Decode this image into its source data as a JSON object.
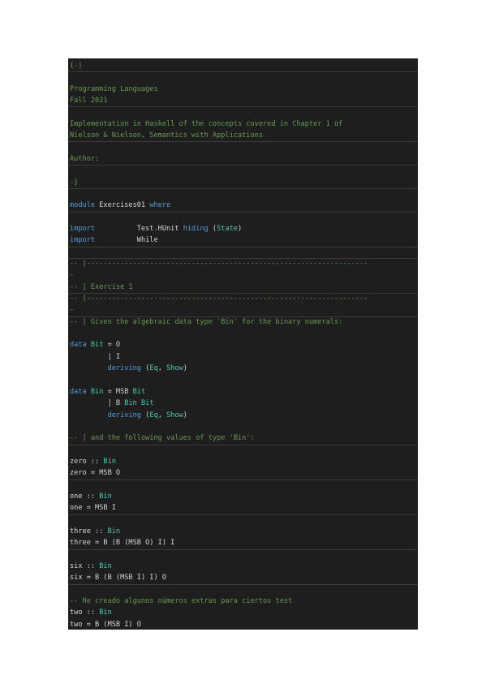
{
  "colors": {
    "background": "#1e1e1e",
    "page": "#ffffff",
    "comment": "#6a9955",
    "keyword": "#569cd6",
    "type": "#4ec9b0",
    "constructor": "#9cdcfe",
    "text": "#d4d4d4"
  },
  "code": {
    "lines": [
      [
        {
          "t": "{-|",
          "k": "comment"
        }
      ],
      [],
      [
        {
          "t": "Programming Languages",
          "k": "comment"
        }
      ],
      [
        {
          "t": "Fall 2021",
          "k": "comment"
        }
      ],
      [],
      [
        {
          "t": "Implementation in Haskell of the concepts covered in Chapter 1 of",
          "k": "comment"
        }
      ],
      [
        {
          "t": "Nielson & Nielson, Semantics with Applications",
          "k": "comment"
        }
      ],
      [],
      [
        {
          "t": "Author:",
          "k": "comment"
        }
      ],
      [],
      [
        {
          "t": "-}",
          "k": "comment"
        }
      ],
      [],
      [
        {
          "t": "module ",
          "k": "kw"
        },
        {
          "t": "Exercises01",
          "k": "plain"
        },
        {
          "t": " where",
          "k": "kw"
        }
      ],
      [],
      [
        {
          "t": "import",
          "k": "kw"
        },
        {
          "t": "          Test.HUnit ",
          "k": "plain"
        },
        {
          "t": "hiding",
          "k": "kw"
        },
        {
          "t": " (",
          "k": "plain"
        },
        {
          "t": "State",
          "k": "type"
        },
        {
          "t": ")",
          "k": "plain"
        }
      ],
      [
        {
          "t": "import",
          "k": "kw"
        },
        {
          "t": "          While",
          "k": "plain"
        }
      ],
      [],
      [
        {
          "t": "-- |-------------------------------------------------------------------",
          "k": "comment"
        }
      ],
      [
        {
          "t": "-",
          "k": "comment"
        }
      ],
      [
        {
          "t": "-- | Exercise 1",
          "k": "comment"
        }
      ],
      [
        {
          "t": "-- |-------------------------------------------------------------------",
          "k": "comment"
        }
      ],
      [
        {
          "t": "-",
          "k": "comment"
        }
      ],
      [
        {
          "t": "-- | Given the algebraic data type 'Bin' for the binary numerals:",
          "k": "comment"
        }
      ],
      [],
      [
        {
          "t": "data ",
          "k": "kw"
        },
        {
          "t": "Bit",
          "k": "type"
        },
        {
          "t": " = O",
          "k": "plain"
        }
      ],
      [
        {
          "t": "         | I",
          "k": "plain"
        }
      ],
      [
        {
          "t": "         ",
          "k": "plain"
        },
        {
          "t": "deriving",
          "k": "kw"
        },
        {
          "t": " (",
          "k": "plain"
        },
        {
          "t": "Eq",
          "k": "type"
        },
        {
          "t": ", ",
          "k": "plain"
        },
        {
          "t": "Show",
          "k": "type"
        },
        {
          "t": ")",
          "k": "plain"
        }
      ],
      [],
      [
        {
          "t": "data ",
          "k": "kw"
        },
        {
          "t": "Bin",
          "k": "type"
        },
        {
          "t": " = MSB ",
          "k": "plain"
        },
        {
          "t": "Bit",
          "k": "type"
        }
      ],
      [
        {
          "t": "         | B ",
          "k": "plain"
        },
        {
          "t": "Bin",
          "k": "type"
        },
        {
          "t": " ",
          "k": "plain"
        },
        {
          "t": "Bit",
          "k": "type"
        }
      ],
      [
        {
          "t": "         ",
          "k": "plain"
        },
        {
          "t": "deriving",
          "k": "kw"
        },
        {
          "t": " (",
          "k": "plain"
        },
        {
          "t": "Eq",
          "k": "type"
        },
        {
          "t": ", ",
          "k": "plain"
        },
        {
          "t": "Show",
          "k": "type"
        },
        {
          "t": ")",
          "k": "plain"
        }
      ],
      [],
      [
        {
          "t": "-- | and the following values of type 'Bin':",
          "k": "comment"
        }
      ],
      [],
      [
        {
          "t": "zero :: ",
          "k": "plain"
        },
        {
          "t": "Bin",
          "k": "type"
        }
      ],
      [
        {
          "t": "zero = MSB O",
          "k": "plain"
        }
      ],
      [],
      [
        {
          "t": "one :: ",
          "k": "plain"
        },
        {
          "t": "Bin",
          "k": "type"
        }
      ],
      [
        {
          "t": "one = MSB I",
          "k": "plain"
        }
      ],
      [],
      [
        {
          "t": "three :: ",
          "k": "plain"
        },
        {
          "t": "Bin",
          "k": "type"
        }
      ],
      [
        {
          "t": "three = B (B (MSB O) I) I",
          "k": "plain"
        }
      ],
      [],
      [
        {
          "t": "six :: ",
          "k": "plain"
        },
        {
          "t": "Bin",
          "k": "type"
        }
      ],
      [
        {
          "t": "six = B (B (MSB I) I) O",
          "k": "plain"
        }
      ],
      [],
      [
        {
          "t": "-- He creado algunos números extras para ciertos test",
          "k": "comment"
        }
      ],
      [
        {
          "t": "two :: ",
          "k": "plain"
        },
        {
          "t": "Bin",
          "k": "type"
        }
      ],
      [
        {
          "t": "two = B (MSB I) O",
          "k": "plain"
        }
      ]
    ]
  }
}
